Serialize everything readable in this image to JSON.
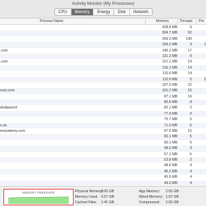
{
  "window": {
    "title": "Activity Monitor (My Processes)"
  },
  "tabs": [
    "CPU",
    "Memory",
    "Energy",
    "Disk",
    "Network"
  ],
  "active_tab": "Memory",
  "columns": {
    "name": "Process Name",
    "memory": "Memory",
    "threads": "Threads",
    "ports": "Por"
  },
  "processes": [
    {
      "name": "",
      "memory": "428.8 MB",
      "threads": "9",
      "ports": "9"
    },
    {
      "name": "",
      "memory": "304.7 MB",
      "threads": "52",
      "ports": "8"
    },
    {
      "name": "",
      "memory": "269.0 MB",
      "threads": "140",
      "ports": "6"
    },
    {
      "name": "",
      "memory": "159.2 MB",
      "threads": "9",
      "ports": "1,8"
    },
    {
      "name": ".com",
      "memory": "146.1 MB",
      "threads": "17",
      "ports": ""
    },
    {
      "name": "",
      "memory": "131.2 MB",
      "threads": "9",
      "ports": ""
    },
    {
      "name": ".com",
      "memory": "121.1 MB",
      "threads": "14",
      "ports": ""
    },
    {
      "name": "",
      "memory": "116.1 MB",
      "threads": "14",
      "ports": ""
    },
    {
      "name": "",
      "memory": "115.6 MB",
      "threads": "14",
      "ports": ""
    },
    {
      "name": "",
      "memory": "110.9 MB",
      "threads": "5",
      "ports": "2,3"
    },
    {
      "name": "",
      "memory": "107.5 MB",
      "threads": "22",
      "ports": ""
    },
    {
      "name": "nors.com",
      "memory": "101.2 MB",
      "threads": "15",
      "ports": ""
    },
    {
      "name": "",
      "memory": "87.1 MB",
      "threads": "16",
      "ports": ""
    },
    {
      "name": "",
      "memory": "85.6 MB",
      "threads": "8",
      "ports": ""
    },
    {
      "name": "dedspeech",
      "memory": "82.1 MB",
      "threads": "2",
      "ports": ""
    },
    {
      "name": "",
      "memory": "77.9 MB",
      "threads": "9",
      "ports": ""
    },
    {
      "name": "",
      "memory": "75.7 MB",
      "threads": "5",
      "ports": ""
    },
    {
      "name": "o.uk",
      "memory": "71.0 MB",
      "threads": "6",
      "ports": ""
    },
    {
      "name": "eracademy.com",
      "memory": "67.5 MB",
      "threads": "15",
      "ports": ""
    },
    {
      "name": "",
      "memory": "60.1 MB",
      "threads": "5",
      "ports": ""
    },
    {
      "name": "",
      "memory": "60.1 MB",
      "threads": "5",
      "ports": ""
    },
    {
      "name": "",
      "memory": "58.6 MB",
      "threads": "3",
      "ports": ""
    },
    {
      "name": "",
      "memory": "57.1 MB",
      "threads": "5",
      "ports": ""
    },
    {
      "name": "",
      "memory": "53.8 MB",
      "threads": "2",
      "ports": ""
    },
    {
      "name": "",
      "memory": "48.6 MB",
      "threads": "4",
      "ports": ""
    },
    {
      "name": "",
      "memory": "46.2 MB",
      "threads": "4",
      "ports": ""
    },
    {
      "name": "",
      "memory": "45.5 MB",
      "threads": "4",
      "ports": ""
    },
    {
      "name": "",
      "memory": "44.0 MB",
      "threads": "4",
      "ports": ""
    }
  ],
  "footer": {
    "pressure_title": "MEMORY PRESSURE",
    "pressure_color": "#9be28f",
    "pressure_line_color": "#5fb85a",
    "pressure_level": 0.78,
    "stats_left": [
      {
        "label": "Physical Memory:",
        "value": "8.00 GB"
      },
      {
        "label": "Memory Used:",
        "value": "6.57 GB"
      },
      {
        "label": "Cached Files:",
        "value": "1.41 GB"
      },
      {
        "label": "Swap Used:",
        "value": "64.0 MB"
      }
    ],
    "stats_right": [
      {
        "label": "App Memory:",
        "value": "2.55 GB"
      },
      {
        "label": "Wired Memory:",
        "value": "1.97 GB"
      },
      {
        "label": "Compressed:",
        "value": "2.05 GB"
      }
    ]
  },
  "colors": {
    "accent_tab": "#6d6d6d",
    "highlight": "#e2373a",
    "row_stripe": "#f1f4f8"
  }
}
